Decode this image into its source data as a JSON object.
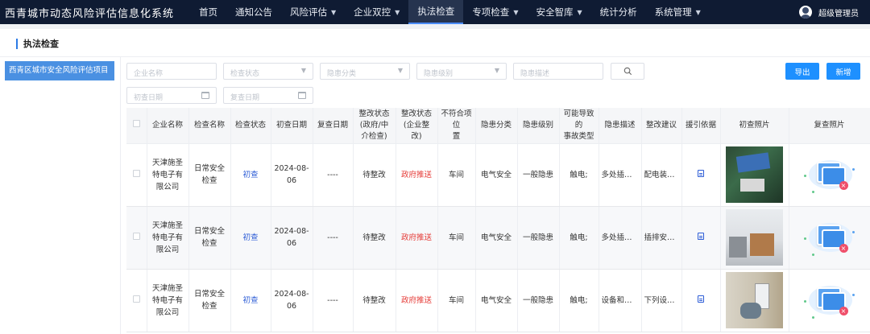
{
  "app": {
    "title": "西青城市动态风险评估信息化系统",
    "user_name": "超级管理员"
  },
  "nav": [
    {
      "label": "首页",
      "has_menu": false,
      "active": false
    },
    {
      "label": "通知公告",
      "has_menu": false,
      "active": false
    },
    {
      "label": "风险评估",
      "has_menu": true,
      "active": false
    },
    {
      "label": "企业双控",
      "has_menu": true,
      "active": false
    },
    {
      "label": "执法检查",
      "has_menu": false,
      "active": true
    },
    {
      "label": "专项检查",
      "has_menu": true,
      "active": false
    },
    {
      "label": "安全智库",
      "has_menu": true,
      "active": false
    },
    {
      "label": "统计分析",
      "has_menu": false,
      "active": false
    },
    {
      "label": "系统管理",
      "has_menu": true,
      "active": false
    }
  ],
  "page_title": "执法检查",
  "tree": {
    "selected_item": "西青区城市安全风险评估项目"
  },
  "filters": {
    "company_name": "企业名称",
    "check_status": "检查状态",
    "hazard_category": "隐患分类",
    "hazard_level": "隐患级别",
    "hazard_description": "隐患描述",
    "first_check_date": "初查日期",
    "recheck_date": "复查日期"
  },
  "buttons": {
    "export": "导出",
    "add": "新增"
  },
  "table": {
    "columns": [
      "企业名称",
      "检查名称",
      "检查状态",
      "初查日期",
      "复查日期",
      "整改状态(政府/中介检查)",
      "整改状态(企业整改)",
      "不符合项位置",
      "隐患分类",
      "隐患级别",
      "可能导致的事故类型",
      "隐患描述",
      "整改建议",
      "援引依据",
      "初查照片",
      "复查照片"
    ],
    "column_lines": [
      [
        "企业名称"
      ],
      [
        "检查名称"
      ],
      [
        "检查状态"
      ],
      [
        "初查日期"
      ],
      [
        "复查日期"
      ],
      [
        "整改状态",
        "(政府/中",
        "介检查)"
      ],
      [
        "整改状态",
        "(企业整",
        "改)"
      ],
      [
        "不符合项位",
        "置"
      ],
      [
        "隐患分类"
      ],
      [
        "隐患级别"
      ],
      [
        "可能导致的",
        "事故类型"
      ],
      [
        "隐患描述"
      ],
      [
        "整改建议"
      ],
      [
        "援引依据"
      ],
      [
        "初查照片"
      ],
      [
        "复查照片"
      ]
    ],
    "rows": [
      {
        "company": "天津施圣特电子有限公司",
        "check_name": "日常安全检查",
        "status": "初查",
        "first_date": "2024-08-06",
        "recheck_date": "----",
        "gov_rectify": "待整改",
        "ent_rectify": "政府推送",
        "location": "车间",
        "category": "电气安全",
        "level": "一般隐患",
        "accident": "触电;",
        "description": "多处插排...",
        "suggestion": "配电装置...",
        "photo": "ph1"
      },
      {
        "company": "天津施圣特电子有限公司",
        "check_name": "日常安全检查",
        "status": "初查",
        "first_date": "2024-08-06",
        "recheck_date": "----",
        "gov_rectify": "待整改",
        "ent_rectify": "政府推送",
        "location": "车间",
        "category": "电气安全",
        "level": "一般隐患",
        "accident": "触电;",
        "description": "多处插排...",
        "suggestion": "插排安装...",
        "photo": "ph2"
      },
      {
        "company": "天津施圣特电子有限公司",
        "check_name": "日常安全检查",
        "status": "初查",
        "first_date": "2024-08-06",
        "recheck_date": "----",
        "gov_rectify": "待整改",
        "ent_rectify": "政府推送",
        "location": "车间",
        "category": "电气安全",
        "level": "一般隐患",
        "accident": "触电;",
        "description": "设备和场...",
        "suggestion": "下列设备...",
        "photo": "ph3"
      }
    ]
  }
}
